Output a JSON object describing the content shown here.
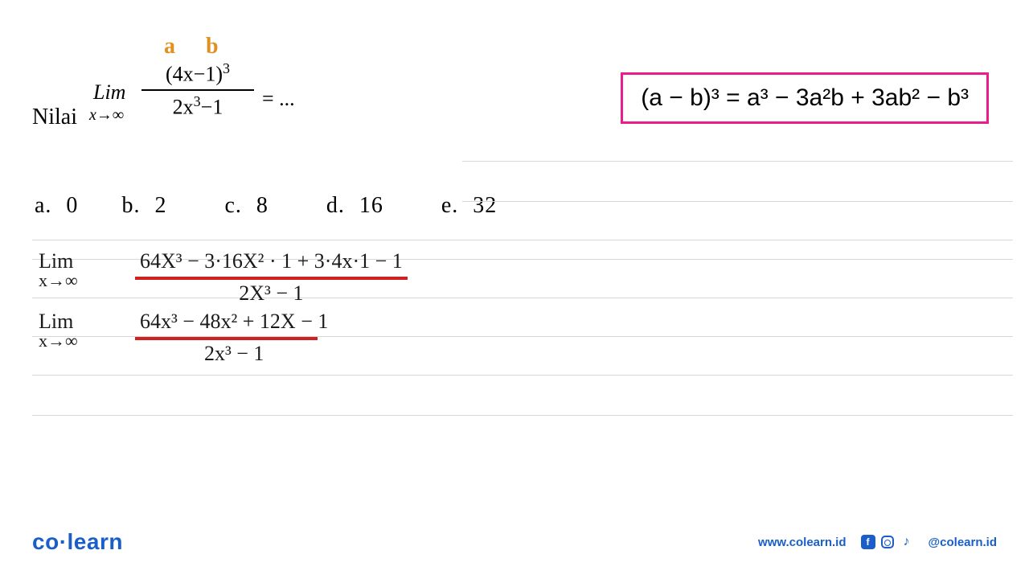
{
  "problem": {
    "prefix": "Nilai",
    "annotations": {
      "a": "a",
      "b": "b"
    },
    "lim_text": "Lim",
    "lim_sub": "x→∞",
    "numerator": "(4x−1)",
    "numerator_power": "3",
    "denominator": "2x",
    "denominator_power": "3",
    "denominator_tail": "−1",
    "suffix": "= ..."
  },
  "formula": {
    "text_html": "(a − b)³  = a³ − 3a²b + 3ab² − b³"
  },
  "options": {
    "a": "a. 0",
    "b": "b. 2",
    "c": "c. 8",
    "d": "d.  16",
    "e": "e.  32"
  },
  "work": {
    "step1": {
      "lim": "Lim",
      "sub": "x→∞",
      "num": "64X³ − 3·16X² · 1 + 3·4x·1 − 1",
      "denom": "2X³ − 1"
    },
    "step2": {
      "lim": "Lim",
      "sub": "x→∞",
      "num": "64x³ − 48x² + 12X − 1",
      "denom": "2x³ − 1"
    }
  },
  "footer": {
    "logo": "co·learn",
    "url": "www.colearn.id",
    "handle": "@colearn.id"
  }
}
